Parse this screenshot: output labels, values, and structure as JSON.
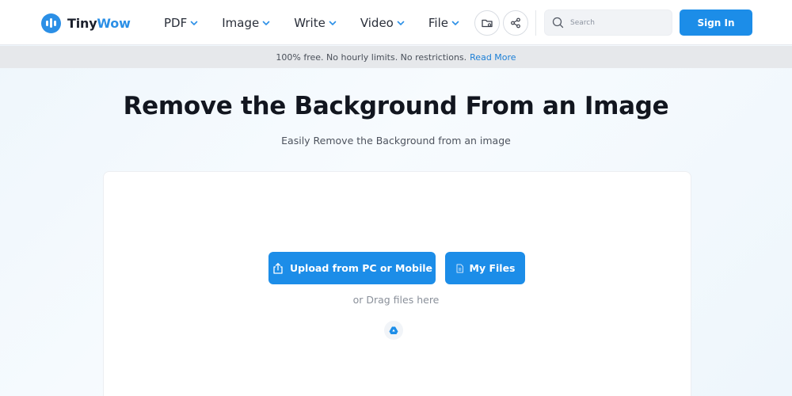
{
  "brand": {
    "name_part1": "Tiny",
    "name_part2": "Wow"
  },
  "nav": {
    "items": [
      {
        "label": "PDF"
      },
      {
        "label": "Image"
      },
      {
        "label": "Write"
      },
      {
        "label": "Video"
      },
      {
        "label": "File"
      }
    ]
  },
  "header": {
    "search_placeholder": "Search",
    "signin_label": "Sign In"
  },
  "banner": {
    "text": "100% free. No hourly limits. No restrictions.",
    "link": "Read More"
  },
  "hero": {
    "title": "Remove the Background From an Image",
    "subtitle": "Easily Remove the Background from an image"
  },
  "upload": {
    "upload_label": "Upload from PC or Mobile",
    "files_label": "My Files",
    "drag_text": "or Drag files here"
  },
  "colors": {
    "accent": "#1c8de8",
    "brand": "#2b8fe6",
    "title_text": "#12161f"
  },
  "icons": {
    "logo": "tinywow-logo-icon",
    "chevron": "chevron-down-icon",
    "folder": "folder-icon",
    "share": "share-icon",
    "search": "search-icon",
    "upload": "upload-icon",
    "files": "file-icon",
    "drive": "google-drive-icon"
  }
}
